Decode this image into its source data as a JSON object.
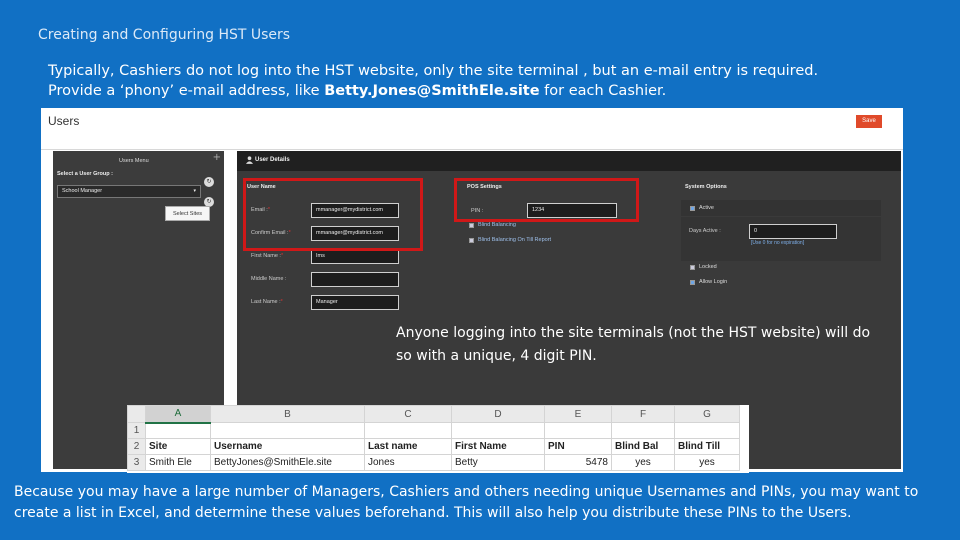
{
  "slide": {
    "title": "Creating and Configuring HST Users",
    "intro_line1": "Typically, Cashiers do not log into the HST website, only the site terminal , but an e-mail entry is required.",
    "intro_line2_pre": "Provide a ‘phony’  e-mail address, like ",
    "intro_line2_bold": "Betty.Jones@SmithEle.site",
    "intro_line2_post": " for each Cashier.",
    "callout": "Anyone logging into the site terminals (not the HST website) will do so with a unique, 4 digit PIN.",
    "footer": "Because you may have a large number of Managers, Cashiers and others needing unique Usernames and PINs, you may want to create a list in Excel, and determine these values beforehand. This will also help you distribute these PINs to the Users."
  },
  "app": {
    "page_title": "Users",
    "save_label": "Save",
    "users_menu_label": "Users Menu",
    "select_group_label": "Select a User Group :",
    "group_value": "School Manager",
    "select_sites_label": "Select Sites",
    "details_title": "User Details",
    "user_name_section": "User Name",
    "pos_section": "POS Settings",
    "system_section": "System Options",
    "fields": {
      "email_label": "Email :",
      "email_value": "mmanager@mydistrict.com",
      "confirm_email_label": "Confirm Email :",
      "confirm_email_value": "mmanager@mydistrict.com",
      "first_name_label": "First Name :",
      "first_name_value": "Ims",
      "middle_name_label": "Middle Name :",
      "last_name_label": "Last Name :",
      "last_name_value": "Manager",
      "pin_label": "PIN :",
      "pin_value": "1234",
      "days_active_label": "Days Active :",
      "days_active_value": "0",
      "days_active_hint": "[Use 0 for no expiration]"
    },
    "checkboxes": {
      "blind_balancing": "Blind Balancing",
      "blind_balancing_till": "Blind Balancing On Till Report",
      "active": "Active",
      "locked": "Locked",
      "allow_login": "Allow Login"
    },
    "icons": {
      "plus": "+",
      "refresh": "↻",
      "user": "user-icon"
    }
  },
  "spreadsheet": {
    "columns": [
      "A",
      "B",
      "C",
      "D",
      "E",
      "F",
      "G"
    ],
    "row_numbers": [
      "1",
      "2",
      "3"
    ],
    "headers": [
      "Site",
      "Username",
      "Last name",
      "First Name",
      "PIN",
      "Blind Bal",
      "Blind Till"
    ],
    "row": [
      "Smith Ele",
      "BettyJones@SmithEle.site",
      "Jones",
      "Betty",
      "5478",
      "yes",
      "yes"
    ]
  },
  "colors": {
    "background": "#1170c4",
    "highlight": "#d01818",
    "save_button": "#e04a2a"
  }
}
